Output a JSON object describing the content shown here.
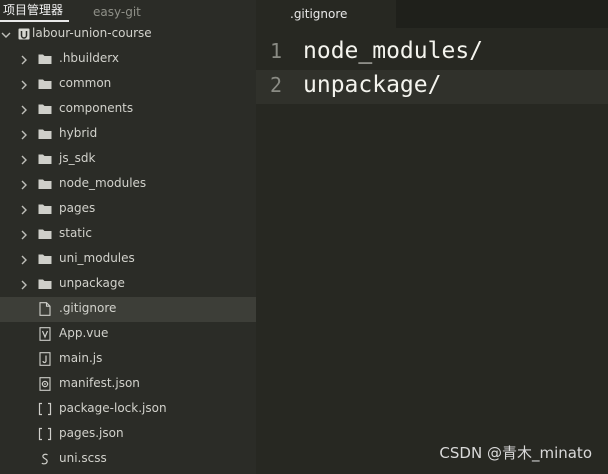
{
  "sidebar": {
    "tabs": [
      {
        "label": "项目管理器",
        "active": true
      },
      {
        "label": "easy-git",
        "active": false
      }
    ],
    "root": {
      "label": "labour-union-course",
      "icon": "project-icon",
      "expanded": true
    },
    "items": [
      {
        "label": ".hbuilderx",
        "type": "folder",
        "icon": "folder-icon"
      },
      {
        "label": "common",
        "type": "folder",
        "icon": "folder-icon"
      },
      {
        "label": "components",
        "type": "folder",
        "icon": "folder-icon"
      },
      {
        "label": "hybrid",
        "type": "folder",
        "icon": "folder-icon"
      },
      {
        "label": "js_sdk",
        "type": "folder",
        "icon": "folder-icon"
      },
      {
        "label": "node_modules",
        "type": "folder",
        "icon": "folder-icon"
      },
      {
        "label": "pages",
        "type": "folder",
        "icon": "folder-icon"
      },
      {
        "label": "static",
        "type": "folder",
        "icon": "folder-icon"
      },
      {
        "label": "uni_modules",
        "type": "folder",
        "icon": "folder-icon"
      },
      {
        "label": "unpackage",
        "type": "folder",
        "icon": "folder-icon"
      },
      {
        "label": ".gitignore",
        "type": "file",
        "icon": "file-icon",
        "selected": true
      },
      {
        "label": "App.vue",
        "type": "file",
        "icon": "vue-file-icon"
      },
      {
        "label": "main.js",
        "type": "file",
        "icon": "js-file-icon"
      },
      {
        "label": "manifest.json",
        "type": "file",
        "icon": "manifest-gear-icon"
      },
      {
        "label": "package-lock.json",
        "type": "file",
        "icon": "json-brackets-icon"
      },
      {
        "label": "pages.json",
        "type": "file",
        "icon": "json-brackets-icon"
      },
      {
        "label": "uni.scss",
        "type": "file",
        "icon": "scss-file-icon"
      }
    ]
  },
  "editor": {
    "tab_label": ".gitignore",
    "lines": [
      {
        "number": "1",
        "text": "node_modules/"
      },
      {
        "number": "2",
        "text": "unpackage/",
        "current": true
      }
    ]
  },
  "watermark": "CSDN @青木_minato",
  "colors": {
    "sidebar_bg": "#2b2c27",
    "editor_bg": "#272822",
    "selected_row": "#3d3e38",
    "current_line": "#30312b"
  }
}
